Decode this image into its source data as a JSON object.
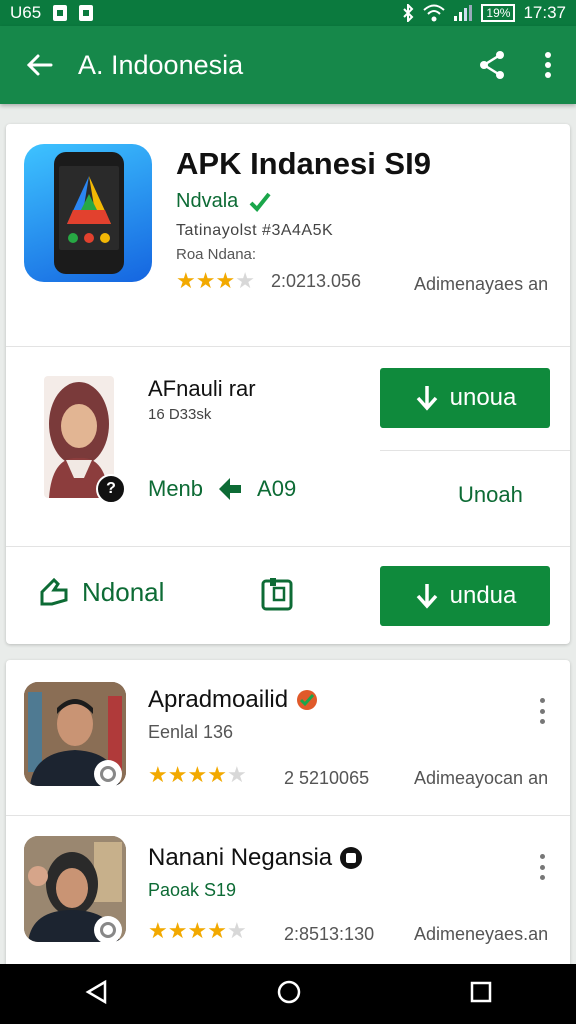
{
  "status_bar": {
    "time_left": "U65",
    "time": "17:37",
    "battery": "19%"
  },
  "app_bar": {
    "title": "A. Indoonesia"
  },
  "featured": {
    "title": "APK Indanesi SI9",
    "developer": "Ndvala",
    "info_line": "Tatinayolst #3A4A5K",
    "info_sub": "Roa Ndana:",
    "rating": 3,
    "rating_count": "2:0213.056",
    "rating_label": "Adimenayaes an"
  },
  "profile": {
    "name": "AFnauli rar",
    "sub": "16 D33sk",
    "badge": "?",
    "link_label": "Menb",
    "version": "A09",
    "download_label": "unoua",
    "secondary_label": "Unoah"
  },
  "actions": {
    "primary_label": "Ndonal",
    "download_label": "undua"
  },
  "list": [
    {
      "title": "Apradmoailid",
      "subtitle": "Eenlal 136",
      "rating": 4,
      "rating_count": "2 5210065",
      "rating_label": "Adimeayocan an"
    },
    {
      "title": "Nanani Negansia",
      "subtitle": "Paoak S19",
      "rating": 4,
      "rating_count": "2:8513:130",
      "rating_label": "Adimeneyaes.an"
    }
  ],
  "colors": {
    "primary": "#16884a",
    "status": "#0b7a3e",
    "button": "#0f8a3c",
    "star": "#f2a900"
  },
  "icons": [
    "back-arrow-icon",
    "share-icon",
    "more-vert-icon",
    "verified-icon",
    "download-icon",
    "thumb-icon",
    "bookmark-icon",
    "nav-back-icon",
    "nav-home-icon",
    "nav-recents-icon"
  ]
}
